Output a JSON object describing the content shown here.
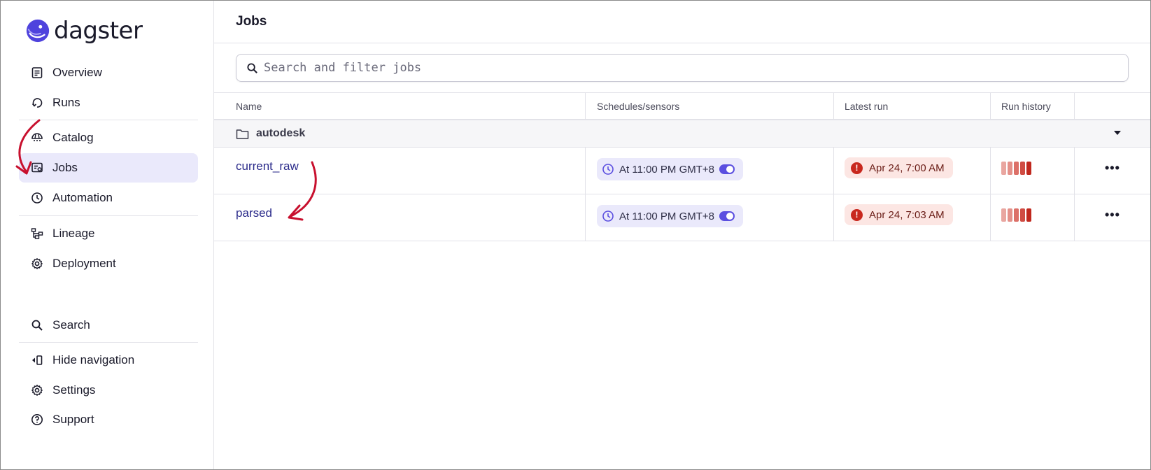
{
  "app": {
    "name": "dagster"
  },
  "sidebar": {
    "items": [
      {
        "label": "Overview",
        "icon": "overview-icon"
      },
      {
        "label": "Runs",
        "icon": "runs-icon"
      },
      {
        "label": "Catalog",
        "icon": "catalog-icon"
      },
      {
        "label": "Jobs",
        "icon": "jobs-icon",
        "active": true
      },
      {
        "label": "Automation",
        "icon": "clock-icon"
      },
      {
        "label": "Lineage",
        "icon": "lineage-icon"
      },
      {
        "label": "Deployment",
        "icon": "gear-icon"
      }
    ],
    "bottom_items": [
      {
        "label": "Search",
        "icon": "search-icon"
      },
      {
        "label": "Hide navigation",
        "icon": "hide-navigation-icon"
      },
      {
        "label": "Settings",
        "icon": "gear-icon"
      },
      {
        "label": "Support",
        "icon": "help-icon"
      }
    ]
  },
  "main": {
    "title": "Jobs",
    "search": {
      "placeholder": "Search and filter jobs",
      "value": ""
    },
    "table": {
      "columns": [
        "Name",
        "Schedules/sensors",
        "Latest run",
        "Run history",
        ""
      ],
      "group": {
        "name": "autodesk"
      },
      "rows": [
        {
          "name": "current_raw",
          "schedule": "At 11:00 PM GMT+8",
          "schedule_enabled": true,
          "latest_run": "Apr 24, 7:00 AM",
          "latest_status": "failure"
        },
        {
          "name": "parsed",
          "schedule": "At 11:00 PM GMT+8",
          "schedule_enabled": true,
          "latest_run": "Apr 24, 7:03 AM",
          "latest_status": "failure"
        }
      ]
    }
  },
  "colors": {
    "accent": "#5b4fe0",
    "active_bg": "#eae9fb",
    "failure": "#c8281e",
    "failure_bg": "#fce6e3",
    "history_bars": [
      "#e9a6a0",
      "#e49089",
      "#dc7068",
      "#d04c43",
      "#c0281e"
    ],
    "annotation_arrow": "#c8102e"
  }
}
